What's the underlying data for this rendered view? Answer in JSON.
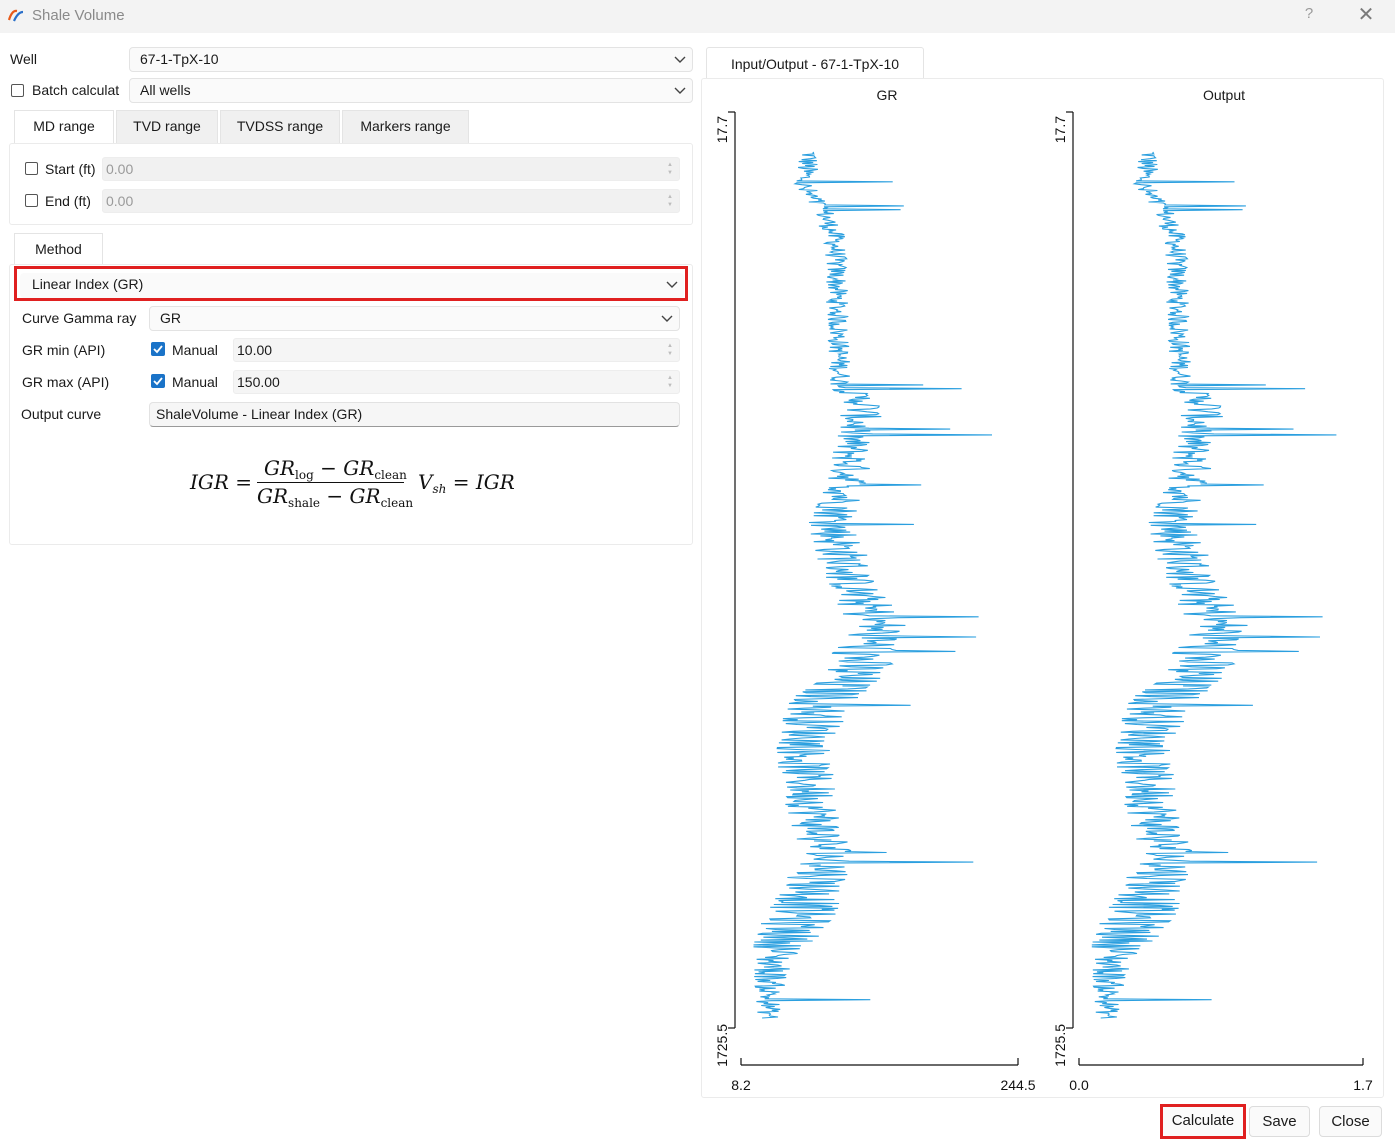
{
  "window": {
    "title": "Shale Volume",
    "help_label": "?",
    "close_label": "✕"
  },
  "form": {
    "well_label": "Well",
    "well_value": "67-1-TpX-10",
    "batch_label": "Batch calculat",
    "batch_value": "All wells",
    "range_tabs": [
      "MD range",
      "TVD range",
      "TVDSS range",
      "Markers range"
    ],
    "start_label": "Start (ft)",
    "start_value": "0.00",
    "end_label": "End (ft)",
    "end_value": "0.00",
    "method_tab": "Method",
    "method_value": "Linear Index (GR)",
    "curve_label": "Curve Gamma ray",
    "curve_value": "GR",
    "grmin_label": "GR min (API)",
    "grmin_manual": "Manual",
    "grmin_value": "10.00",
    "grmax_label": "GR max (API)",
    "grmax_manual": "Manual",
    "grmax_value": "150.00",
    "output_label": "Output curve",
    "output_value": "ShaleVolume - Linear Index (GR)"
  },
  "formula": {
    "lhs": "IGR =",
    "num_a": "GR",
    "num_a_sub": "log",
    "num_b": "GR",
    "num_b_sub": "clean",
    "den_a": "GR",
    "den_a_sub": "shale",
    "den_b": "GR",
    "den_b_sub": "clean",
    "minus": "−",
    "vsh": "V",
    "vsh_sub": "sh",
    "rhs": "= IGR"
  },
  "plot": {
    "tab_label": "Input/Output - 67-1-TpX-10",
    "tracks": [
      {
        "title": "GR",
        "depth_top": "17.7",
        "depth_bottom": "1725.5",
        "x_min": "8.2",
        "x_max": "244.5",
        "color": "#2b9fdf"
      },
      {
        "title": "Output",
        "depth_top": "17.7",
        "depth_bottom": "1725.5",
        "x_min": "0.0",
        "x_max": "1.7",
        "color": "#2b9fdf"
      }
    ]
  },
  "buttons": {
    "calculate": "Calculate",
    "save": "Save",
    "close": "Close"
  },
  "colors": {
    "accent": "#1a73c8",
    "highlight": "#e02020",
    "curve": "#2b9fdf"
  },
  "icons": {
    "app": "app-logo-icon",
    "dropdown": "chevron-down-icon",
    "checkbox": "checkbox-icon"
  }
}
